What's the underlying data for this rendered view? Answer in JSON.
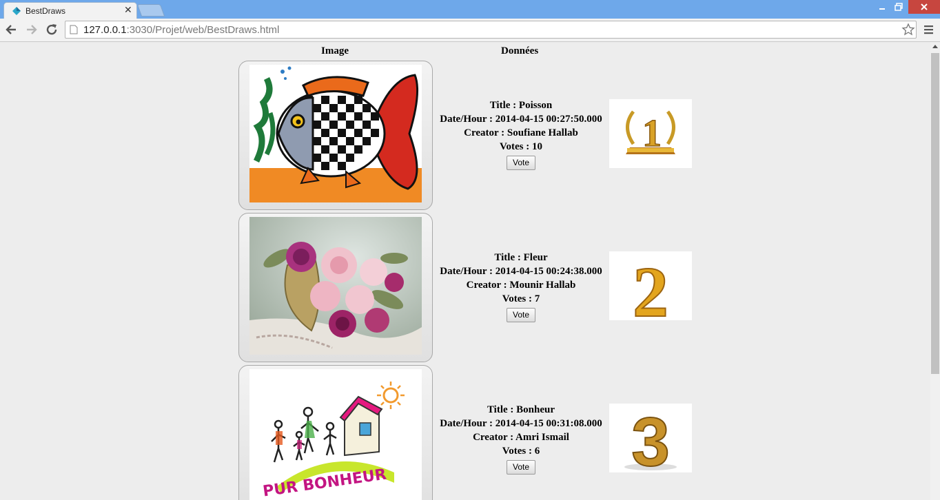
{
  "browser": {
    "tab_title": "BestDraws",
    "url_host": "127.0.0.1",
    "url_rest": ":3030/Projet/web/BestDraws.html"
  },
  "table": {
    "col_image": "Image",
    "col_data": "Données"
  },
  "draws": [
    {
      "title": "Title : Poisson",
      "date": "Date/Hour : 2014-04-15 00:27:50.000",
      "creator": "Creator : Soufiane Hallab",
      "votes": "Votes : 10",
      "vote_label": "Vote",
      "rank": "1",
      "image_subject": "fish-drawing"
    },
    {
      "title": "Title : Fleur",
      "date": "Date/Hour : 2014-04-15 00:24:38.000",
      "creator": "Creator : Mounir Hallab",
      "votes": "Votes : 7",
      "vote_label": "Vote",
      "rank": "2",
      "image_subject": "flower-basket-painting"
    },
    {
      "title": "Title : Bonheur",
      "date": "Date/Hour : 2014-04-15 00:31:08.000",
      "creator": "Creator : Amri Ismail",
      "votes": "Votes : 6",
      "vote_label": "Vote",
      "rank": "3",
      "image_subject": "family-house-drawing",
      "image_text": "PUR BONHEUR"
    }
  ],
  "colors": {
    "titlebar": "#6ea8ea",
    "page_bg": "#ededed",
    "gold": "#d9a227",
    "close_red": "#c7463f"
  }
}
